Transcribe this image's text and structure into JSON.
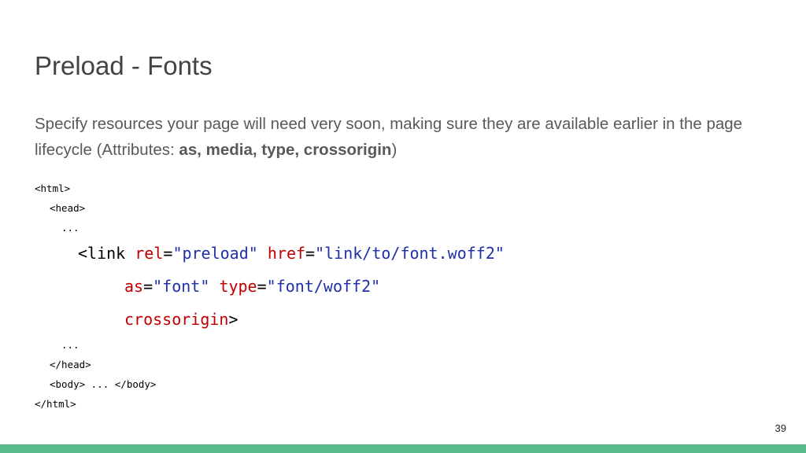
{
  "slide": {
    "title": "Preload - Fonts",
    "description_prefix": "Specify resources your page will need very soon, making sure they are available earlier in the page lifecycle (Attributes: ",
    "description_attrs": "as, media, type, crossorigin",
    "description_suffix": ")",
    "page_number": "39"
  },
  "code": {
    "html_open": "<html>",
    "head_open": "<head>",
    "ellipsis_1": "...",
    "link_open": "<link",
    "rel_attr": "rel",
    "rel_value": "\"preload\"",
    "href_attr": "href",
    "href_value": "\"link/to/font.woff2\"",
    "as_attr": "as",
    "as_value": "\"font\"",
    "type_attr": "type",
    "type_value": "\"font/woff2\"",
    "crossorigin_attr": "crossorigin",
    "tag_close": ">",
    "equals": "=",
    "ellipsis_2": "...",
    "head_close": "</head>",
    "body_line": "<body> ... </body>",
    "html_close": "</html>"
  },
  "colors": {
    "title": "#434343",
    "text": "#595959",
    "attribute": "#c00000",
    "value": "#1f2fa8",
    "footer_bar": "#57bb8a"
  }
}
